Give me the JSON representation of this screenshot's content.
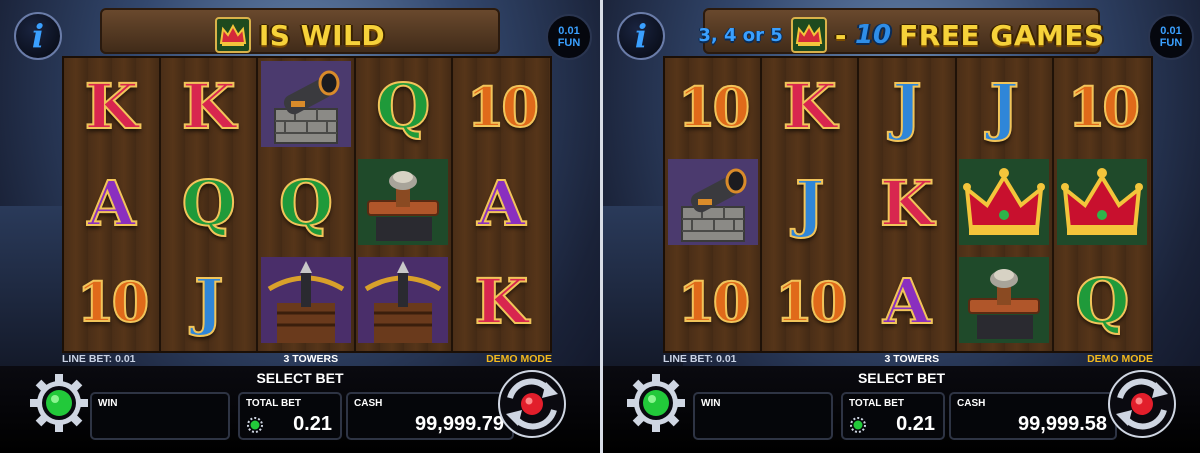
{
  "panels": [
    {
      "banner": {
        "kind": "wild",
        "text": "IS WILD"
      },
      "info_label": "i",
      "fun": {
        "amount": "0.01",
        "label": "FUN"
      },
      "reels": [
        [
          "K",
          "K",
          "cannon",
          "Q",
          "10"
        ],
        [
          "A",
          "Q",
          "Q",
          "catapult",
          "A"
        ],
        [
          "10",
          "J",
          "crossbow",
          "crossbow",
          "K"
        ]
      ],
      "status": {
        "line_bet": "LINE BET: 0.01",
        "towers": "3 TOWERS",
        "mode": "DEMO MODE"
      },
      "select_bet": "SELECT BET",
      "win": {
        "label": "WIN",
        "value": ""
      },
      "total_bet": {
        "label": "TOTAL BET",
        "value": "0.21"
      },
      "cash": {
        "label": "CASH",
        "value": "99,999.79"
      }
    },
    {
      "banner": {
        "kind": "free",
        "prefix": "3, 4 or 5",
        "dash": "-",
        "num": "10",
        "text": "FREE GAMES"
      },
      "info_label": "i",
      "fun": {
        "amount": "0.01",
        "label": "FUN"
      },
      "reels": [
        [
          "10",
          "K",
          "J",
          "J",
          "10"
        ],
        [
          "cannon",
          "J",
          "K",
          "crown",
          "crown"
        ],
        [
          "10",
          "10",
          "A",
          "catapult",
          "Q"
        ]
      ],
      "status": {
        "line_bet": "LINE BET: 0.01",
        "towers": "3 TOWERS",
        "mode": "DEMO MODE"
      },
      "select_bet": "SELECT BET",
      "win": {
        "label": "WIN",
        "value": ""
      },
      "total_bet": {
        "label": "TOTAL BET",
        "value": "0.21"
      },
      "cash": {
        "label": "CASH",
        "value": "99,999.58"
      }
    }
  ],
  "colors": {
    "accent_blue": "#3aa0ff",
    "gold": "#f6d23a",
    "demo_orange": "#f3b91d",
    "gear_green": "#22c93a",
    "spin_red": "#e21e2b"
  }
}
